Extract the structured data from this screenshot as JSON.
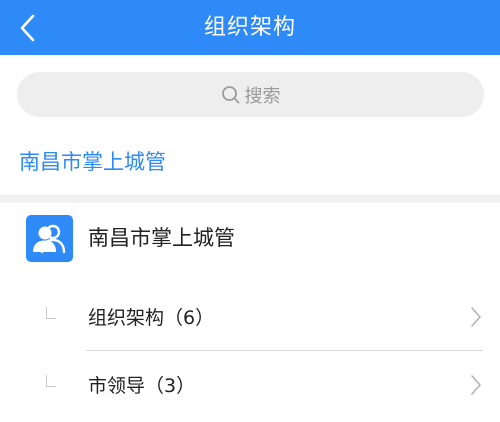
{
  "header": {
    "title": "组织架构",
    "back_icon": "chevron-left-icon",
    "background": "#2e8af6"
  },
  "search": {
    "placeholder": "搜索",
    "icon": "search-icon"
  },
  "org_link": {
    "label": "南昌市掌上城管",
    "color": "#2e8af6"
  },
  "org": {
    "name": "南昌市掌上城管",
    "avatar_icon": "group-users-icon"
  },
  "tree": {
    "items": [
      {
        "label": "组织架构（6）",
        "icon": "chevron-right-icon"
      },
      {
        "label": "市领导（3）",
        "icon": "chevron-right-icon"
      }
    ]
  }
}
